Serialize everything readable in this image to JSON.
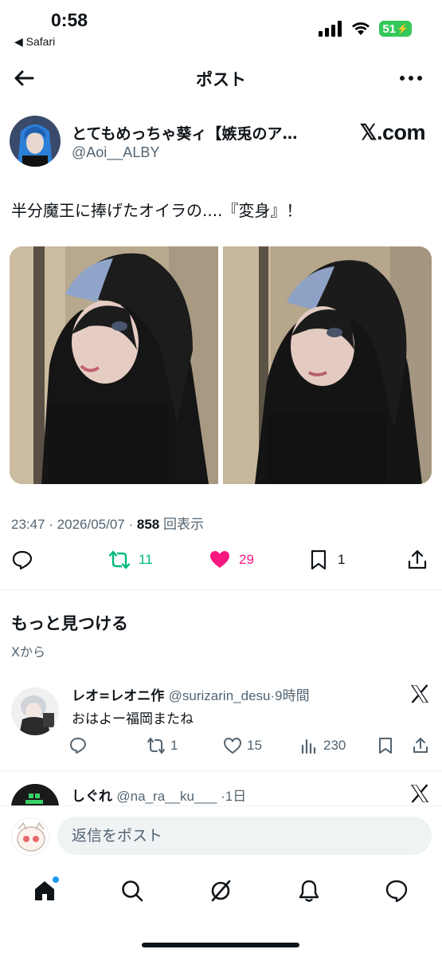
{
  "status": {
    "time": "0:58",
    "back_app": "◀ Safari",
    "battery": "51"
  },
  "header": {
    "title": "ポスト"
  },
  "post": {
    "author_name": "とてもめっちゃ葵ィ【嫉兎のア…",
    "author_handle": "@Aoi__ALBY",
    "badge": "𝕏.com",
    "text": "半分魔王に捧げたオイラの....『変身』！",
    "time": "23:47",
    "date": "2026/05/07",
    "views": "858",
    "views_label": "回表示",
    "reposts": "11",
    "likes": "29",
    "bookmarks": "1"
  },
  "discover": {
    "title": "もっと見つける",
    "subtitle": "Xから"
  },
  "related_posts": [
    {
      "name": "レオ=レオニ作",
      "handle": "@surizarin_desu",
      "time": "9時間",
      "text": "おはよー福岡またね",
      "replies": "",
      "reposts": "1",
      "likes": "15",
      "views": "230"
    },
    {
      "name": "しぐれ",
      "handle": "@na_ra__ku___",
      "time": "1日"
    }
  ],
  "reply": {
    "placeholder": "返信をポスト"
  },
  "colors": {
    "like": "#f91880",
    "repost": "#00ba7c",
    "secondary": "#536471",
    "accent": "#1d9bf0"
  }
}
